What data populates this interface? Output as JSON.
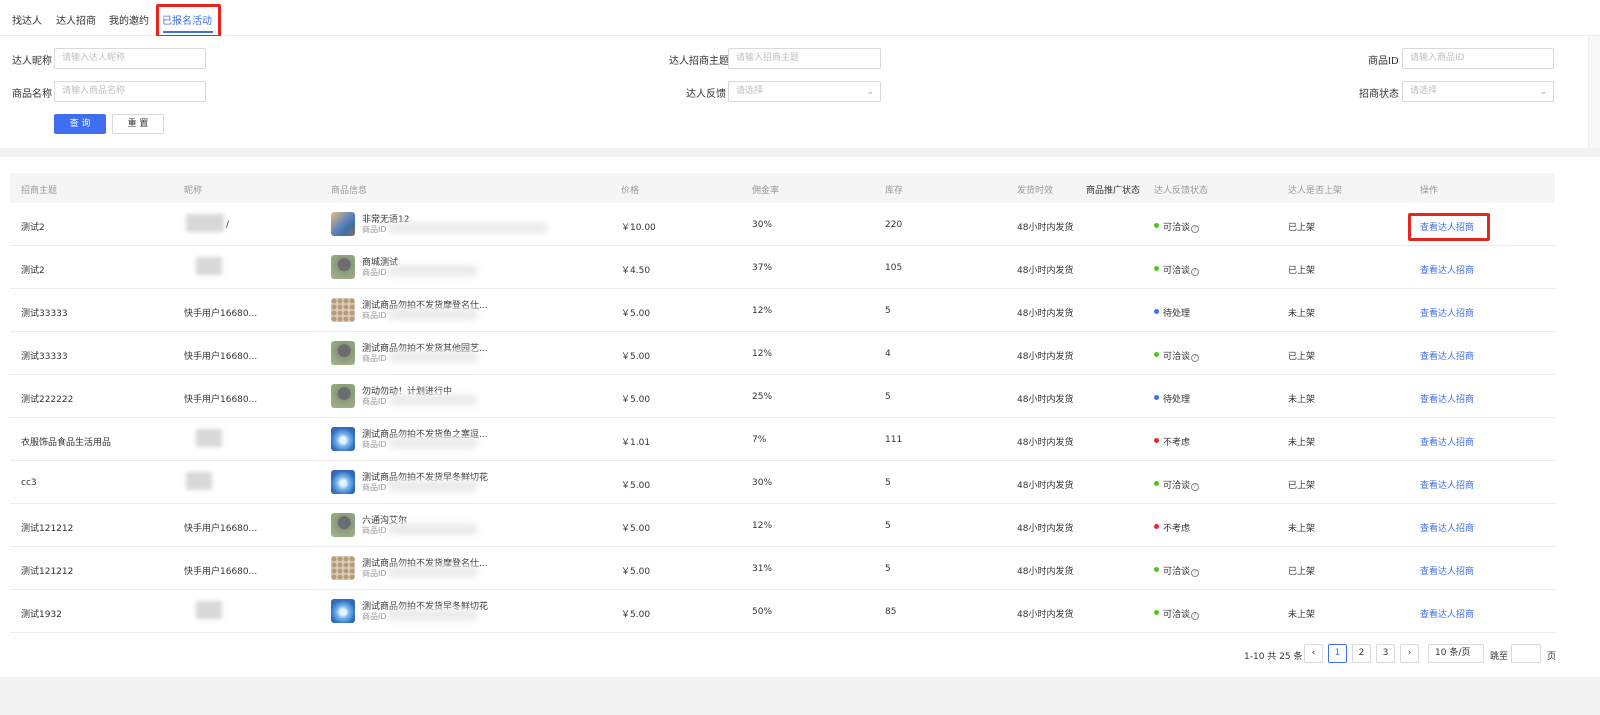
{
  "tabs": [
    {
      "label": "找达人"
    },
    {
      "label": "达人招商"
    },
    {
      "label": "我的邀约"
    },
    {
      "label": "已报名活动"
    }
  ],
  "filters": {
    "nickname_label": "达人昵称",
    "nickname_placeholder": "请输入达人昵称",
    "theme_label": "达人招商主题",
    "theme_placeholder": "请输入招商主题",
    "product_id_label": "商品ID",
    "product_id_placeholder": "请输入商品ID",
    "product_name_label": "商品名称",
    "product_name_placeholder": "请输入商品名称",
    "feedback_label": "达人反馈",
    "feedback_placeholder": "请选择",
    "status_label": "招商状态",
    "status_placeholder": "请选择",
    "query_button": "查 询",
    "reset_button": "重 置"
  },
  "table": {
    "headers": [
      "招商主题",
      "昵称",
      "商品信息",
      "价格",
      "佣金率",
      "库存",
      "发货时效",
      "商品推广状态",
      "达人反馈状态",
      "达人是否上架",
      "操作"
    ],
    "rows": [
      {
        "theme": "测试2",
        "nickname": "/",
        "product": "非常无语12",
        "pid": "商品ID",
        "price": "￥10.00",
        "commission": "30%",
        "stock": "220",
        "ship": "48小时内发货",
        "feedback": "可洽谈",
        "feedback_color": "#52c41a",
        "has_help": true,
        "listed": "已上架",
        "action": "查看达人招商",
        "thumb": "mix"
      },
      {
        "theme": "测试2",
        "nickname": "",
        "product": "商城测试",
        "pid": "商品ID",
        "price": "￥4.50",
        "commission": "37%",
        "stock": "105",
        "ship": "48小时内发货",
        "feedback": "可洽谈",
        "feedback_color": "#52c41a",
        "has_help": true,
        "listed": "已上架",
        "action": "查看达人招商",
        "thumb": "cat"
      },
      {
        "theme": "测试33333",
        "nickname": "快手用户16680...",
        "product": "测试商品勿拍不发货摩登名仕...",
        "pid": "商品ID",
        "price": "￥5.00",
        "commission": "12%",
        "stock": "5",
        "ship": "48小时内发货",
        "feedback": "待处理",
        "feedback_color": "#3f6ff0",
        "has_help": false,
        "listed": "未上架",
        "action": "查看达人招商",
        "thumb": "grid"
      },
      {
        "theme": "测试33333",
        "nickname": "快手用户16680...",
        "product": "测试商品勿拍不发货其他园艺...",
        "pid": "商品ID",
        "price": "￥5.00",
        "commission": "12%",
        "stock": "4",
        "ship": "48小时内发货",
        "feedback": "可洽谈",
        "feedback_color": "#52c41a",
        "has_help": true,
        "listed": "已上架",
        "action": "查看达人招商",
        "thumb": "cat"
      },
      {
        "theme": "测试222222",
        "nickname": "快手用户16680...",
        "product": "勿动勿动！计划进行中",
        "pid": "商品ID",
        "price": "￥5.00",
        "commission": "25%",
        "stock": "5",
        "ship": "48小时内发货",
        "feedback": "待处理",
        "feedback_color": "#3f6ff0",
        "has_help": false,
        "listed": "未上架",
        "action": "查看达人招商",
        "thumb": "cat"
      },
      {
        "theme": "衣服饰品食品生活用品",
        "nickname": "",
        "product": "测试商品勿拍不发货鱼之塞逗...",
        "pid": "商品ID",
        "price": "￥1.01",
        "commission": "7%",
        "stock": "111",
        "ship": "48小时内发货",
        "feedback": "不考虑",
        "feedback_color": "#f5222d",
        "has_help": false,
        "listed": "未上架",
        "action": "查看达人招商",
        "thumb": "blue"
      },
      {
        "theme": "cc3",
        "nickname": "",
        "product": "测试商品勿拍不发货早冬鲜切花",
        "pid": "商品ID",
        "price": "￥5.00",
        "commission": "30%",
        "stock": "5",
        "ship": "48小时内发货",
        "feedback": "可洽谈",
        "feedback_color": "#52c41a",
        "has_help": true,
        "listed": "已上架",
        "action": "查看达人招商",
        "thumb": "blue"
      },
      {
        "theme": "测试121212",
        "nickname": "快手用户16680...",
        "product": "六通沟艾尔",
        "pid": "商品ID",
        "price": "￥5.00",
        "commission": "12%",
        "stock": "5",
        "ship": "48小时内发货",
        "feedback": "不考虑",
        "feedback_color": "#f5222d",
        "has_help": false,
        "listed": "未上架",
        "action": "查看达人招商",
        "thumb": "cat"
      },
      {
        "theme": "测试121212",
        "nickname": "快手用户16680...",
        "product": "测试商品勿拍不发货摩登名仕...",
        "pid": "商品ID",
        "price": "￥5.00",
        "commission": "31%",
        "stock": "5",
        "ship": "48小时内发货",
        "feedback": "可洽谈",
        "feedback_color": "#52c41a",
        "has_help": true,
        "listed": "已上架",
        "action": "查看达人招商",
        "thumb": "grid"
      },
      {
        "theme": "测试1932",
        "nickname": "",
        "product": "测试商品勿拍不发货早冬鲜切花",
        "pid": "商品ID",
        "price": "￥5.00",
        "commission": "50%",
        "stock": "85",
        "ship": "48小时内发货",
        "feedback": "可洽谈",
        "feedback_color": "#52c41a",
        "has_help": true,
        "listed": "未上架",
        "action": "查看达人招商",
        "thumb": "blue"
      }
    ]
  },
  "pagination": {
    "summary": "1-10 共 25 条",
    "prev": "‹",
    "pages": [
      "1",
      "2",
      "3"
    ],
    "next": "›",
    "page_size": "10 条/页",
    "jump_label": "跳至",
    "page_unit": "页"
  }
}
